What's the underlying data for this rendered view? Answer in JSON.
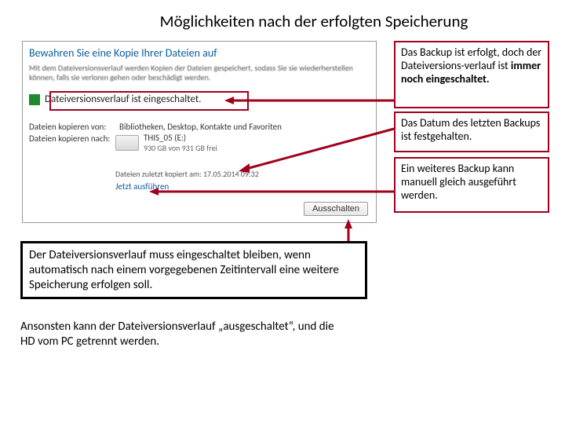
{
  "title": "Möglichkeiten nach der erfolgten Speicherung",
  "dialog": {
    "heading": "Bewahren Sie eine Kopie Ihrer Dateien auf",
    "desc": "Mit dem Dateiversionsverlauf werden Kopien der Dateien gespeichert, sodass Sie sie wiederherstellen können, falls sie verloren gehen oder beschädigt werden.",
    "status": "Dateiversionsverlauf ist eingeschaltet.",
    "row_from_lbl": "Dateien kopieren von:",
    "row_from_val": "Bibliotheken, Desktop, Kontakte und Favoriten",
    "row_to_lbl": "Dateien kopieren nach:",
    "drive_name": "THIS_05 (E:)",
    "drive_free": "930 GB von 931 GB frei",
    "date_prefix": "Dateien zuletzt kopiert am: ",
    "date_value": "17.05.2014 09:32",
    "link_run": "Jetzt ausführen",
    "btn_off": "Ausschalten"
  },
  "ann": {
    "a1a": "Das Backup ist erfolgt, doch der Dateiversions-verlauf ist ",
    "a1b": "immer noch eingeschaltet.",
    "a2": "Das Datum des letzten Backups ist festgehalten.",
    "a3": "Ein weiteres Backup kann manuell gleich ausgeführt werden."
  },
  "bottom": {
    "box": "Der Dateiversionsverlauf muss eingeschaltet bleiben, wenn automatisch nach einem vorgegebenen Zeitintervall eine weitere Speicherung erfolgen soll.",
    "plain": "Ansonsten kann der Dateiversionsverlauf „ausgeschaltet“, und die HD vom PC getrennt werden."
  }
}
